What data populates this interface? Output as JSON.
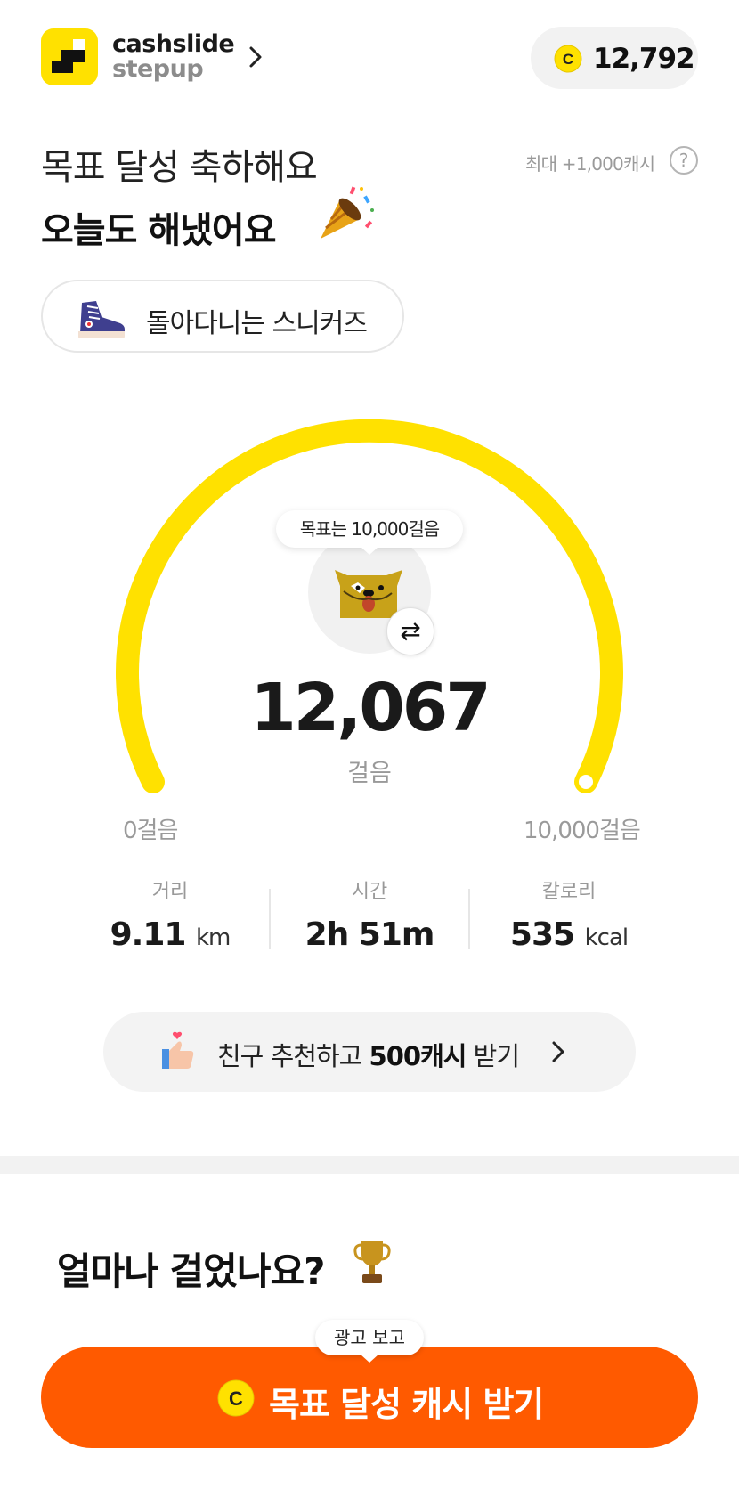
{
  "header": {
    "brand_line1": "cashslide",
    "brand_line2": "stepup",
    "coin_balance": "12,792",
    "coin_symbol": "C"
  },
  "hero": {
    "title_line1": "목표 달성 축하해요",
    "title_line2": "오늘도 해냈어요",
    "max_cash": "최대 +1,000캐시",
    "help_symbol": "?",
    "sneaker_label": "돌아다니는 스니커즈"
  },
  "gauge": {
    "goal_tooltip": "목표는 10,000걸음",
    "steps": "12,067",
    "steps_unit": "걸음",
    "min_label": "0걸음",
    "max_label": "10,000걸음",
    "progress": 1.0
  },
  "stats": [
    {
      "label": "거리",
      "value": "9.11",
      "unit": "km"
    },
    {
      "label": "시간",
      "value": "2h 51m",
      "unit": ""
    },
    {
      "label": "칼로리",
      "value": "535",
      "unit": "kcal"
    }
  ],
  "referral": {
    "text_before": "친구 추천하고 ",
    "text_bold": "500캐시",
    "text_after": " 받기"
  },
  "section": {
    "walk_title": "얼마나 걸었나요?"
  },
  "cta": {
    "ad_tooltip": "광고 보고",
    "label": "목표 달성 캐시 받기",
    "coin_symbol": "C"
  },
  "colors": {
    "gauge": "#FFE100",
    "cta": "#FF5A00",
    "coin": "#FFE100"
  },
  "icons": [
    "logo-icon",
    "chevron-right-icon",
    "coin-icon",
    "party-popper-icon",
    "help-icon",
    "sneaker-icon",
    "character-icon",
    "swap-icon",
    "thumbs-up-icon",
    "trophy-icon"
  ]
}
